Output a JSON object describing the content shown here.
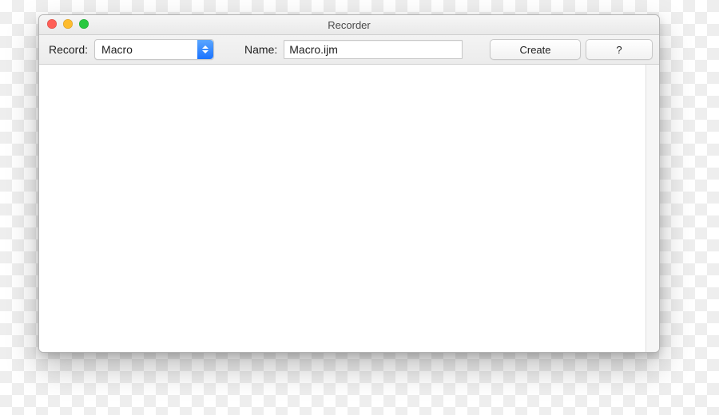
{
  "window": {
    "title": "Recorder"
  },
  "toolbar": {
    "record_label": "Record:",
    "record_select": {
      "value": "Macro"
    },
    "name_label": "Name:",
    "name_field_value": "Macro.ijm",
    "buttons": {
      "create": "Create",
      "help": "?"
    }
  },
  "content": {
    "text": ""
  }
}
